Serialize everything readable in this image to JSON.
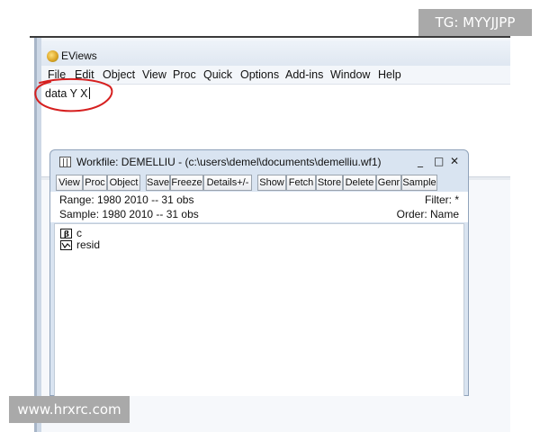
{
  "watermarks": {
    "top": "TG: MYYJJPP",
    "bottom": "www.hrxrc.com"
  },
  "app": {
    "title": "EViews"
  },
  "menu": [
    "File",
    "Edit",
    "Object",
    "View",
    "Proc",
    "Quick",
    "Options",
    "Add-ins",
    "Window",
    "Help"
  ],
  "command": {
    "text": "data  Y X"
  },
  "annotation_color": "#d62020",
  "workfile": {
    "title": "Workfile: DEMELLIU - (c:\\users\\demel\\documents\\demelliu.wf1)",
    "controls": {
      "minimize": "_",
      "maximize": "□",
      "close": "✕"
    },
    "toolbar": [
      "View",
      "Proc",
      "Object",
      "Save",
      "Freeze",
      "Details+/-",
      "Show",
      "Fetch",
      "Store",
      "Delete",
      "Genr",
      "Sample"
    ],
    "range": "Range:  1980 2010  --  31 obs",
    "sample": "Sample: 1980 2010  --  31 obs",
    "filter": "Filter: *",
    "order": "Order: Name",
    "objects": [
      {
        "name": "c",
        "icon": "coefficient-icon"
      },
      {
        "name": "resid",
        "icon": "series-icon"
      }
    ]
  }
}
